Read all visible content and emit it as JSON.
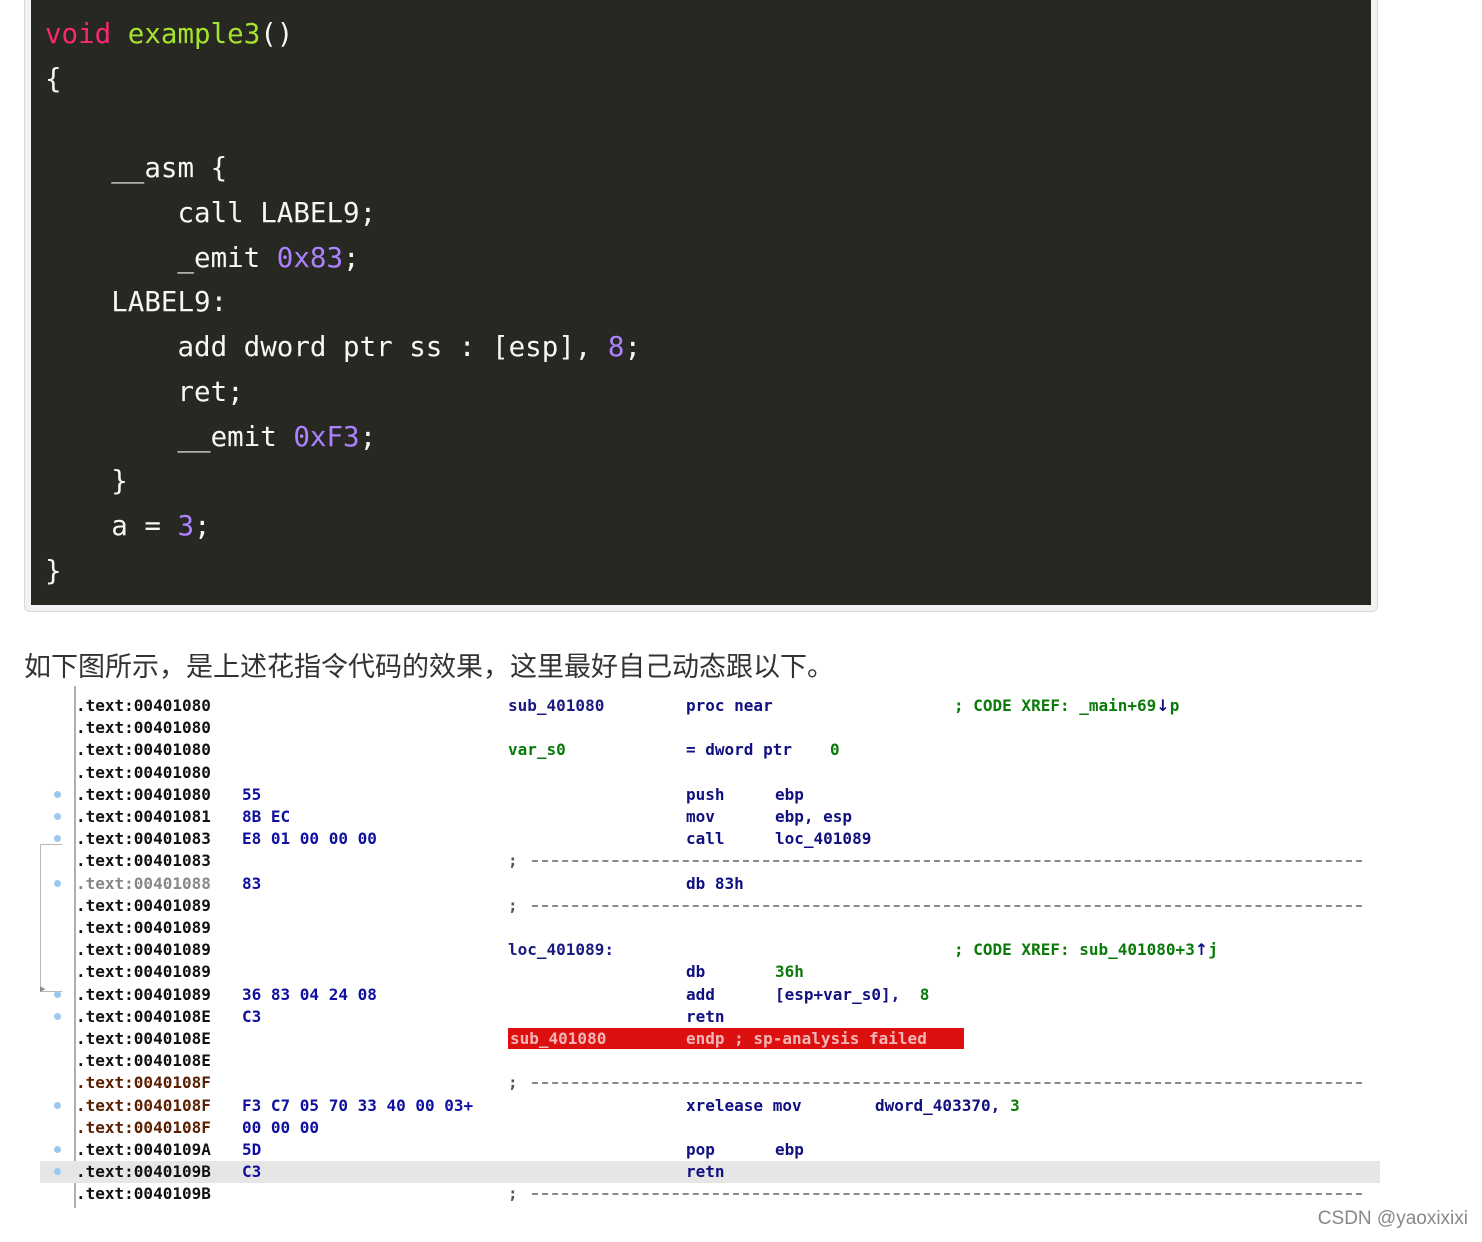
{
  "code_block": {
    "lines": [
      [
        "void",
        " ",
        "example3",
        "()"
      ],
      [
        "{"
      ],
      [
        ""
      ],
      [
        "    __asm {"
      ],
      [
        "        call LABEL9;"
      ],
      [
        "        _emit ",
        "0x83",
        ";"
      ],
      [
        "    LABEL9:"
      ],
      [
        "        add dword ptr ss : [esp], ",
        "8",
        ";"
      ],
      [
        "        ret;"
      ],
      [
        "        __emit ",
        "0xF3",
        ";"
      ],
      [
        "    }"
      ],
      [
        "    a = ",
        "3",
        ";"
      ],
      [
        "}"
      ]
    ]
  },
  "paragraph": "如下图所示，是上述花指令代码的效果，这里最好自己动态跟以下。",
  "ida": {
    "rows": [
      {
        "addr": ".text:00401080",
        "label": "sub_401080",
        "mn": "proc near",
        "cmt": "; CODE XREF: _main+69",
        "cmt_arrow": "↓",
        "cmt_tail": "p"
      },
      {
        "addr": ".text:00401080"
      },
      {
        "addr": ".text:00401080",
        "label": "var_s0",
        "mn": "= dword ptr",
        "op2_num": "0"
      },
      {
        "addr": ".text:00401080"
      },
      {
        "addr": ".text:00401080",
        "bytes": "55",
        "mn": "push",
        "op": "ebp",
        "dot": true
      },
      {
        "addr": ".text:00401081",
        "bytes": "8B EC",
        "mn": "mov",
        "op": "ebp, esp",
        "dot": true
      },
      {
        "addr": ".text:00401083",
        "bytes": "E8 01 00 00 00",
        "mn": "call",
        "op": "loc_401089",
        "dot": true
      },
      {
        "addr": ".text:00401083",
        "sep": ";"
      },
      {
        "addr": ".text:00401088",
        "bytes": "83",
        "mn": "db 83h",
        "dot": true,
        "gray": true
      },
      {
        "addr": ".text:00401089",
        "sep": ";"
      },
      {
        "addr": ".text:00401089"
      },
      {
        "addr": ".text:00401089",
        "label": "loc_401089:",
        "cmt": "; CODE XREF: sub_401080+3",
        "cmt_arrow": "↑",
        "cmt_tail": "j"
      },
      {
        "addr": ".text:00401089",
        "mn": "db",
        "op_green": "36h"
      },
      {
        "addr": ".text:00401089",
        "bytes": "36 83 04 24 08",
        "mn": "add",
        "op": "[esp+var_s0], ",
        "op_num": "8",
        "dot": true
      },
      {
        "addr": ".text:0040108E",
        "bytes": "C3",
        "mn": "retn",
        "dot": true
      },
      {
        "addr": ".text:0040108E",
        "endp_label": "sub_401080",
        "endp_text": "endp ; sp-analysis failed"
      },
      {
        "addr": ".text:0040108E"
      },
      {
        "addr": ".text:0040108F",
        "sep": ";",
        "brown": true
      },
      {
        "addr": ".text:0040108F",
        "bytes": "F3 C7 05 70 33 40 00 03+",
        "mn": "xrelease mov",
        "op2": "dword_403370, ",
        "op2_num": "3",
        "dot": true,
        "brown": true
      },
      {
        "addr": ".text:0040108F",
        "bytes": "00 00 00",
        "brown": true
      },
      {
        "addr": ".text:0040109A",
        "bytes": "5D",
        "mn": "pop",
        "op": "ebp",
        "dot": true
      },
      {
        "addr": ".text:0040109B",
        "bytes": "C3",
        "mn": "retn",
        "dot": true,
        "hl": true
      },
      {
        "addr": ".text:0040109B",
        "sep": ";"
      }
    ]
  },
  "watermark": "CSDN @yaoxixixi"
}
